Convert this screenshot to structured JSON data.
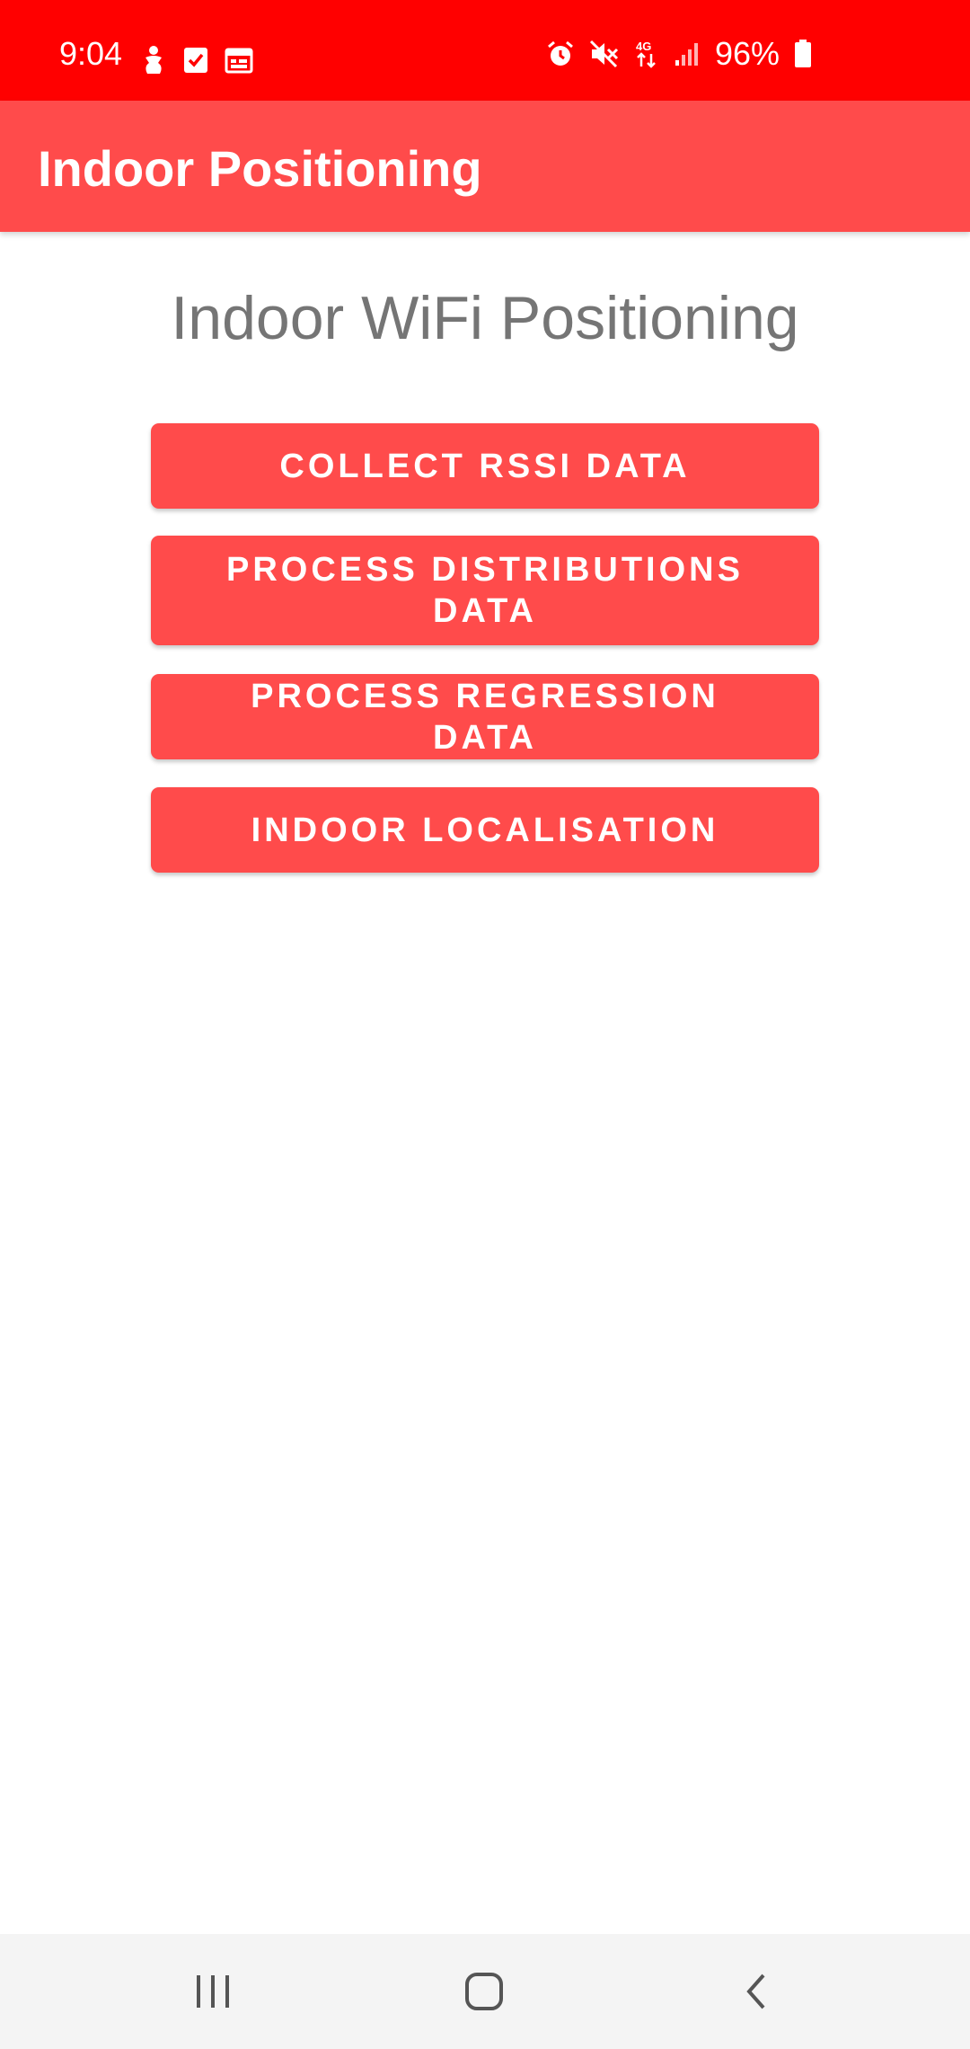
{
  "status_bar": {
    "time": "9:04",
    "battery": "96%",
    "left_icons": [
      "accessibility-icon",
      "checkbox-icon",
      "calendar-icon"
    ],
    "right_icons": [
      "alarm-icon",
      "mute-icon",
      "network-4g-icon",
      "signal-icon",
      "battery-icon"
    ],
    "color": "#ff0000"
  },
  "app_bar": {
    "title": "Indoor Positioning",
    "color": "#ff4b4b"
  },
  "main": {
    "heading": "Indoor WiFi Positioning",
    "buttons": [
      {
        "label": "COLLECT RSSI DATA"
      },
      {
        "label": "PROCESS DISTRIBUTIONS DATA"
      },
      {
        "label": "PROCESS REGRESSION DATA"
      },
      {
        "label": "INDOOR LOCALISATION"
      }
    ]
  },
  "nav_bar": {
    "items": [
      "recent-apps-icon",
      "home-icon",
      "back-icon"
    ]
  }
}
